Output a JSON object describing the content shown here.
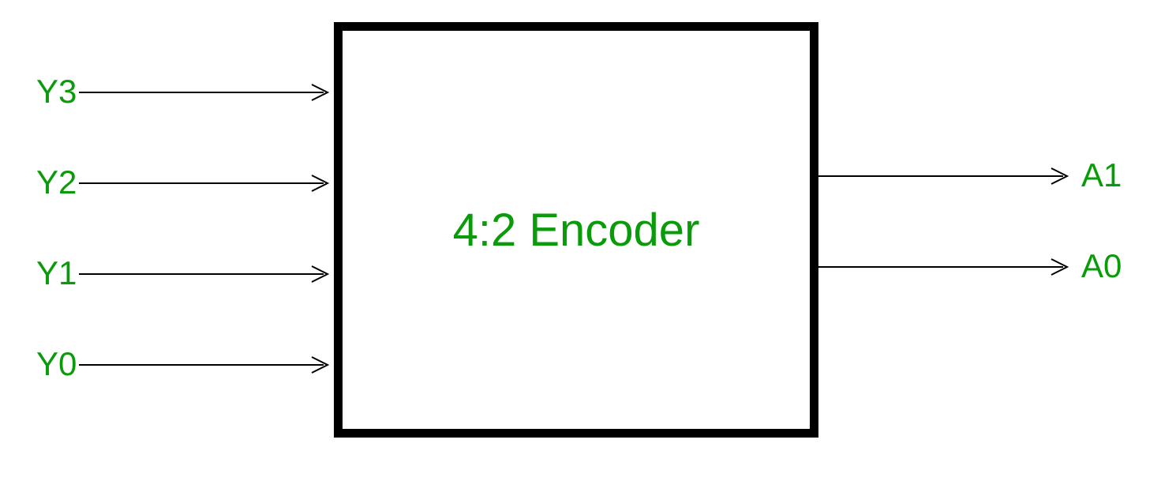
{
  "encoder": {
    "label": "4:2 Encoder"
  },
  "inputs": [
    {
      "label": "Y3"
    },
    {
      "label": "Y2"
    },
    {
      "label": "Y1"
    },
    {
      "label": "Y0"
    }
  ],
  "outputs": [
    {
      "label": "A1"
    },
    {
      "label": "A0"
    }
  ],
  "colors": {
    "text": "#0a9b0a",
    "box_border": "#000000",
    "arrow": "#000000"
  }
}
